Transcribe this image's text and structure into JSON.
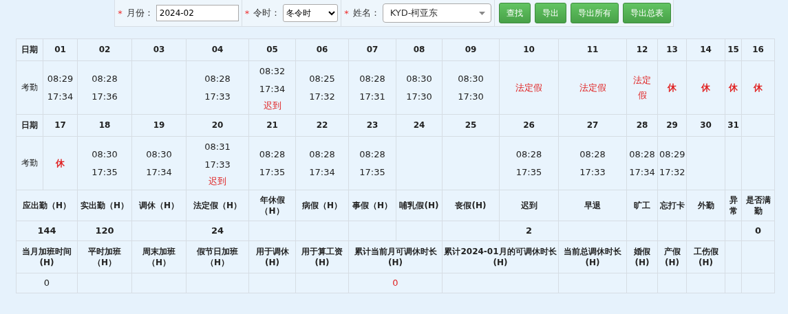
{
  "filters": [
    {
      "kind": "text",
      "required_mark": "*",
      "label": "月份：",
      "value": "2024-02"
    },
    {
      "kind": "select",
      "required_mark": "*",
      "label": "令时：",
      "value": "冬令时"
    },
    {
      "kind": "combo",
      "required_mark": "*",
      "label": "姓名：",
      "value": "KYD-柯亚东"
    }
  ],
  "buttons": [
    "查找",
    "导出",
    "导出所有",
    "导出总表"
  ],
  "calendar": [
    {
      "date_label": "日期",
      "row_label": "考勤",
      "days": [
        {
          "date": "01",
          "kind": "times",
          "times": [
            "08:29",
            "17:34"
          ]
        },
        {
          "date": "02",
          "kind": "times",
          "times": [
            "08:28",
            "17:36"
          ]
        },
        {
          "date": "03",
          "kind": "none"
        },
        {
          "date": "04",
          "kind": "times",
          "times": [
            "08:28",
            "17:33"
          ]
        },
        {
          "date": "05",
          "kind": "times",
          "times": [
            "08:32",
            "17:34"
          ],
          "note": "迟到"
        },
        {
          "date": "06",
          "kind": "times",
          "times": [
            "08:25",
            "17:32"
          ]
        },
        {
          "date": "07",
          "kind": "times",
          "times": [
            "08:28",
            "17:31"
          ]
        },
        {
          "date": "08",
          "kind": "times",
          "times": [
            "08:30",
            "17:30"
          ]
        },
        {
          "date": "09",
          "kind": "times",
          "times": [
            "08:30",
            "17:30"
          ]
        },
        {
          "date": "10",
          "kind": "holiday",
          "note": "法定假"
        },
        {
          "date": "11",
          "kind": "holiday",
          "note": "法定假"
        },
        {
          "date": "12",
          "kind": "holiday",
          "note": "法定假"
        },
        {
          "date": "13",
          "kind": "rest",
          "note": "休"
        },
        {
          "date": "14",
          "kind": "rest",
          "note": "休"
        },
        {
          "date": "15",
          "kind": "rest",
          "note": "休"
        },
        {
          "date": "16",
          "kind": "rest",
          "note": "休"
        }
      ]
    },
    {
      "date_label": "日期",
      "row_label": "考勤",
      "days": [
        {
          "date": "17",
          "kind": "rest",
          "note": "休"
        },
        {
          "date": "18",
          "kind": "times",
          "times": [
            "08:30",
            "17:35"
          ]
        },
        {
          "date": "19",
          "kind": "times",
          "times": [
            "08:30",
            "17:34"
          ]
        },
        {
          "date": "20",
          "kind": "times",
          "times": [
            "08:31",
            "17:33"
          ],
          "note": "迟到"
        },
        {
          "date": "21",
          "kind": "times",
          "times": [
            "08:28",
            "17:35"
          ]
        },
        {
          "date": "22",
          "kind": "times",
          "times": [
            "08:28",
            "17:34"
          ]
        },
        {
          "date": "23",
          "kind": "times",
          "times": [
            "08:28",
            "17:35"
          ]
        },
        {
          "date": "24",
          "kind": "none"
        },
        {
          "date": "25",
          "kind": "none"
        },
        {
          "date": "26",
          "kind": "times",
          "times": [
            "08:28",
            "17:35"
          ]
        },
        {
          "date": "27",
          "kind": "times",
          "times": [
            "08:28",
            "17:33"
          ]
        },
        {
          "date": "28",
          "kind": "times",
          "times": [
            "08:28",
            "17:34"
          ]
        },
        {
          "date": "29",
          "kind": "times",
          "times": [
            "08:29",
            "17:32"
          ]
        },
        {
          "date": "30",
          "kind": "none"
        },
        {
          "date": "31",
          "kind": "none"
        }
      ]
    }
  ],
  "summary": [
    {
      "label": "应出勤（H）",
      "value": "144"
    },
    {
      "label": "实出勤（H）",
      "value": "120"
    },
    {
      "label": "调休（H）"
    },
    {
      "label": "法定假（H）",
      "value": "24"
    },
    {
      "label": "年休假（H）"
    },
    {
      "label": "病假（H）"
    },
    {
      "label": "事假（H）"
    },
    {
      "label": "哺乳假(H)"
    },
    {
      "label": "丧假(H)"
    },
    {
      "label": "迟到",
      "value": "2"
    },
    {
      "label": "早退"
    },
    {
      "label": "旷工"
    },
    {
      "label": "忘打卡"
    },
    {
      "label": "外勤"
    },
    {
      "label": "异常"
    },
    {
      "label": "是否满勤",
      "value": "0"
    }
  ],
  "overtime": [
    {
      "label": "当月加班时间(H)",
      "value": "0",
      "alert": false
    },
    {
      "label": "平时加班（H）"
    },
    {
      "label": "周末加班（H）"
    },
    {
      "label": "假节日加班（H）"
    },
    {
      "label": "用于调休(H)"
    },
    {
      "label": "用于算工资(H)"
    },
    {
      "label": "累计当前月可调休时长(H)",
      "value": "0",
      "alert": true
    },
    {
      "label": "累计**2024-01**月的可调休时长(H)"
    },
    {
      "label": "当前总调休时长(H)"
    },
    {
      "label": "婚假(H)"
    },
    {
      "label": "产假(H)"
    },
    {
      "label": "工伤假(H)"
    }
  ]
}
